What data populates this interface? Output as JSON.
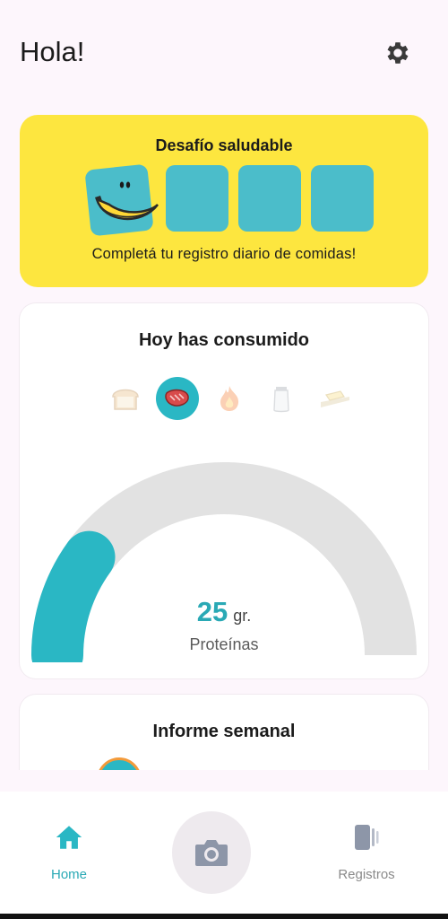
{
  "header": {
    "greeting": "Hola!",
    "settings_icon": "gear-icon"
  },
  "challenge": {
    "title": "Desafío saludable",
    "subtitle": "Completá tu registro diario de comidas!",
    "mascot_icon": "banana-icon",
    "days_total": 4,
    "days_completed": 1,
    "background_color": "#fde63f",
    "tile_color": "#4bbdca"
  },
  "today": {
    "title": "Hoy has consumido",
    "nutrients": [
      {
        "icon": "bread-icon",
        "selected": false
      },
      {
        "icon": "meat-icon",
        "selected": true
      },
      {
        "icon": "fire-icon",
        "selected": false
      },
      {
        "icon": "salt-shaker-icon",
        "selected": false
      },
      {
        "icon": "butter-icon",
        "selected": false
      }
    ],
    "value": "25",
    "unit": "gr.",
    "label": "Proteínas",
    "gauge_fraction": 0.2,
    "gauge_color": "#2ab7c4",
    "track_color": "#e2e2e2"
  },
  "weekly": {
    "title": "Informe semanal"
  },
  "nav": {
    "home_label": "Home",
    "home_icon": "home-icon",
    "camera_icon": "camera-icon",
    "records_label": "Registros",
    "records_icon": "records-icon",
    "active_color": "#2aa9b5"
  }
}
